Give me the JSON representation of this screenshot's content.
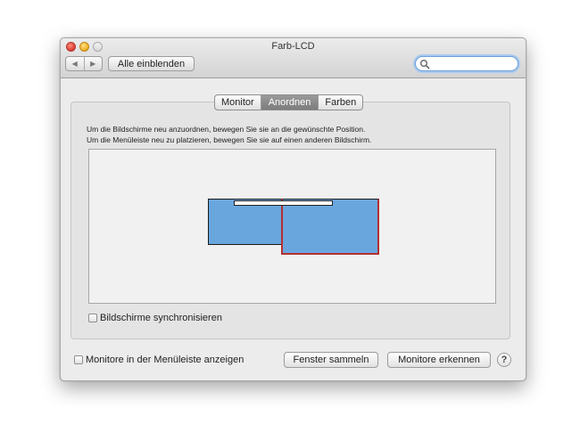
{
  "window": {
    "title": "Farb-LCD"
  },
  "toolbar": {
    "back_icon": "◀",
    "forward_icon": "▶",
    "show_all_label": "Alle einblenden",
    "search": {
      "value": "",
      "placeholder": ""
    }
  },
  "tabs": [
    {
      "label": "Monitor",
      "active": false
    },
    {
      "label": "Anordnen",
      "active": true
    },
    {
      "label": "Farben",
      "active": false
    }
  ],
  "instructions": [
    "Um die Bildschirme neu anzuordnen, bewegen Sie sie an die gewünschte Position.",
    "Um die Menüleiste neu zu platzieren, bewegen Sie sie auf einen anderen Bildschirm."
  ],
  "arrangement": {
    "display_color": "#6aa6de",
    "selected_border_color": "#b33030"
  },
  "mirror_checkbox": {
    "label": "Bildschirme synchronisieren",
    "checked": false
  },
  "menubar_checkbox": {
    "label": "Monitore in der Menüleiste anzeigen",
    "checked": false
  },
  "buttons": {
    "gather": "Fenster sammeln",
    "detect": "Monitore erkennen",
    "help": "?"
  }
}
